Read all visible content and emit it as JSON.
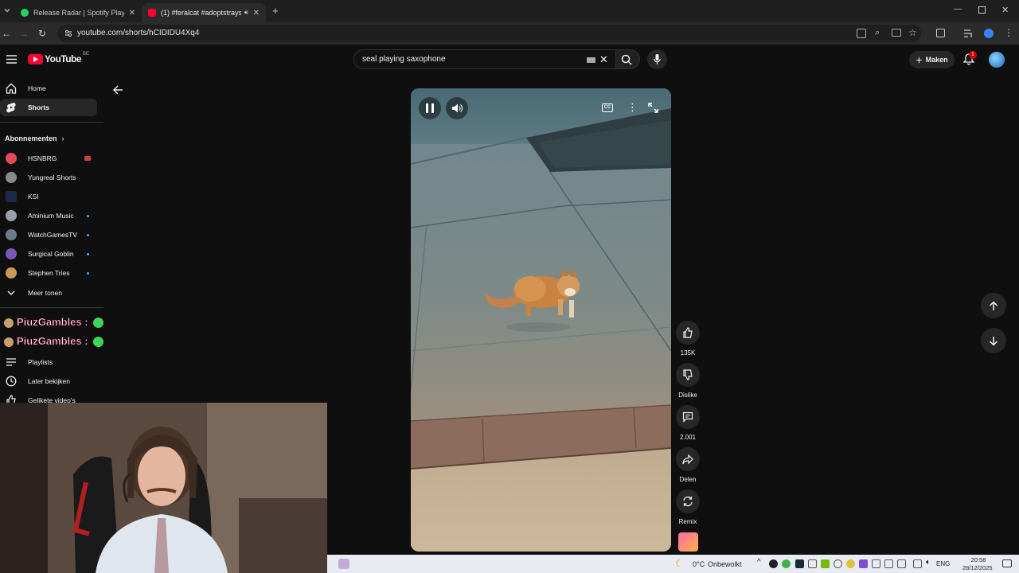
{
  "browser": {
    "tabs": [
      {
        "title": "Release Radar | Spotify Playlist",
        "active": false
      },
      {
        "title": "(1) #feralcat #adoptstrays #",
        "active": true
      }
    ],
    "url": "youtube.com/shorts/hCIDIDU4Xq4"
  },
  "header": {
    "logo_text": "YouTube",
    "region": "BE",
    "search_value": "seal playing saxophone",
    "create_label": "Maken",
    "notification_count": "1"
  },
  "sidebar": {
    "items": [
      {
        "label": "Home",
        "icon": "home-icon"
      },
      {
        "label": "Shorts",
        "icon": "shorts-icon"
      }
    ],
    "subscriptions_heading": "Abonnementen",
    "subscriptions": [
      {
        "label": "HSNBRG",
        "badge": "live"
      },
      {
        "label": "Yungreal Shorts",
        "badge": ""
      },
      {
        "label": "KSI",
        "badge": ""
      },
      {
        "label": "Aminium Music",
        "badge": "new"
      },
      {
        "label": "WatchGamesTV",
        "badge": "new"
      },
      {
        "label": "Surgical Goblin",
        "badge": "new"
      },
      {
        "label": "Stephen Tries",
        "badge": "new"
      }
    ],
    "show_more": "Meer tonen",
    "chat_overlay": [
      "PiuzGambles :",
      "PiuzGambles :"
    ],
    "you_items": [
      {
        "label": "Playlists",
        "icon": "playlist-icon"
      },
      {
        "label": "Later bekijken",
        "icon": "clock-icon"
      },
      {
        "label": "Gelikete video's",
        "icon": "like-icon"
      }
    ]
  },
  "actions": {
    "likes": "135K",
    "dislike": "Dislike",
    "comments": "2.001",
    "share": "Delen",
    "remix": "Remix"
  },
  "taskbar": {
    "weather_temp": "0°C",
    "weather_text": "Onbewolkt",
    "language": "ENG",
    "time": "20:58",
    "date": "28/12/2025"
  },
  "colors": {
    "youtube_red": "#ff0033",
    "background": "#0f0f0f",
    "chip": "#272727"
  }
}
